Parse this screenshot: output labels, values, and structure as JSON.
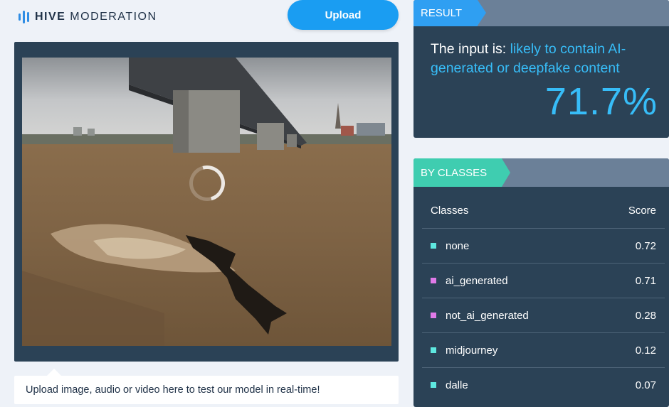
{
  "header": {
    "brand_bold": "HIVE",
    "brand_light": "MODERATION",
    "logo_icon": "hive-bars-icon",
    "upload_label": "Upload",
    "accent": "#1a9df2"
  },
  "preview": {
    "image_description_icon": "river-bridge-photo",
    "loading_icon": "spinner-icon",
    "hint": "Upload image, audio or video here to test our model in real-time!"
  },
  "result": {
    "header": "RESULT",
    "prefix": "The input is: ",
    "verdict": "likely to contain AI-generated or deepfake content",
    "score": "71.7%",
    "highlight_color": "#37bdf8"
  },
  "classes": {
    "header": "BY CLASSES",
    "col_class": "Classes",
    "col_score": "Score",
    "rows": [
      {
        "name": "none",
        "score": "0.72",
        "color": "#5ee8e0"
      },
      {
        "name": "ai_generated",
        "score": "0.71",
        "color": "#e07ae8"
      },
      {
        "name": "not_ai_generated",
        "score": "0.28",
        "color": "#e07ae8"
      },
      {
        "name": "midjourney",
        "score": "0.12",
        "color": "#5ee8e0"
      },
      {
        "name": "dalle",
        "score": "0.07",
        "color": "#5ee8e0"
      }
    ]
  }
}
